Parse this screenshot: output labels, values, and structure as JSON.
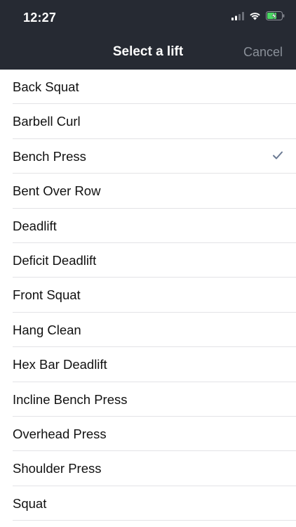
{
  "status_bar": {
    "time": "12:27",
    "icons": [
      "cellular-signal-icon",
      "wifi-icon",
      "battery-charging-icon"
    ]
  },
  "nav": {
    "title": "Select a lift",
    "cancel_label": "Cancel"
  },
  "colors": {
    "header_bg": "#262a33",
    "cancel_text": "#8a9099",
    "checkmark": "#6b7a93",
    "battery_fill": "#4cd964"
  },
  "lifts": {
    "items": [
      {
        "label": "Back Squat",
        "selected": false
      },
      {
        "label": "Barbell Curl",
        "selected": false
      },
      {
        "label": "Bench Press",
        "selected": true
      },
      {
        "label": "Bent Over Row",
        "selected": false
      },
      {
        "label": "Deadlift",
        "selected": false
      },
      {
        "label": "Deficit Deadlift",
        "selected": false
      },
      {
        "label": "Front Squat",
        "selected": false
      },
      {
        "label": "Hang Clean",
        "selected": false
      },
      {
        "label": "Hex Bar Deadlift",
        "selected": false
      },
      {
        "label": "Incline Bench Press",
        "selected": false
      },
      {
        "label": "Overhead Press",
        "selected": false
      },
      {
        "label": "Shoulder Press",
        "selected": false
      },
      {
        "label": "Squat",
        "selected": false
      }
    ]
  }
}
